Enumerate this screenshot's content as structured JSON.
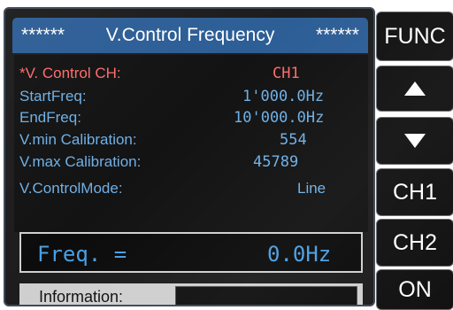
{
  "title": {
    "left_stars": "******",
    "text": "V.Control Frequency",
    "right_stars": "******"
  },
  "params": [
    {
      "label": "*V. Control CH:",
      "value": "CH1",
      "active": true
    },
    {
      "label": "StartFreq:",
      "value": "1'000.0Hz",
      "active": false
    },
    {
      "label": "EndFreq:",
      "value": "10'000.0Hz",
      "active": false
    },
    {
      "label": "V.min Calibration:",
      "value": "554",
      "active": false
    },
    {
      "label": "V.max Calibration:",
      "value": "45789",
      "active": false
    },
    {
      "label": "V.ControlMode:",
      "value": "Line",
      "active": false
    }
  ],
  "freq": {
    "label": "Freq. =",
    "value": "0.0Hz"
  },
  "info": {
    "label": "Information:",
    "value": ""
  },
  "softkeys": {
    "func": "FUNC",
    "up": "up-arrow-icon",
    "down": "down-arrow-icon",
    "ch1": "CH1",
    "ch2": "CH2",
    "on": "ON"
  },
  "colors": {
    "title_bg": "#2d5e96",
    "label_blue": "#6fb0e6",
    "active_red": "#ff6b6b",
    "freq_blue": "#4a9fe3"
  }
}
